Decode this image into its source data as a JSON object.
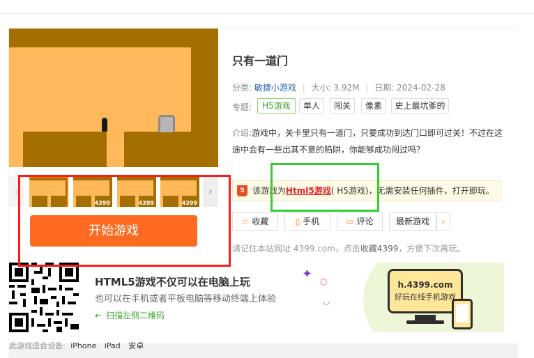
{
  "game": {
    "title": "只有一道门",
    "category_label": "分类:",
    "category": "敏捷小游戏",
    "size_label": "大小:",
    "size": "3.92M",
    "date_label": "日期:",
    "date": "2024-02-28",
    "topics_label": "专题:",
    "topics": [
      "H5游戏",
      "单人",
      "闯关",
      "像素",
      "史上最坑爹的"
    ],
    "intro_label": "介绍:",
    "intro": "游戏中，关卡里只有一道门，只要成功到达门口即可过关！不过在这途中会有一些出其不意的陷阱，你能够成功闯过吗？"
  },
  "thumbnails": {
    "items": [
      {
        "tag": ""
      },
      {
        "tag": "4399"
      },
      {
        "tag": "4399"
      },
      {
        "tag": "4399"
      }
    ],
    "prev_arrow": "‹",
    "next_arrow": "›"
  },
  "start_button": "开始游戏",
  "h5_notice": {
    "icon": "5",
    "prefix": "该游戏为",
    "highlight": "Html5游戏",
    "suffix": "( H5游戏)，无需安装任何插件，打开即玩。"
  },
  "actions": {
    "favorite": "收藏",
    "mobile": "手机",
    "comment": "评论",
    "latest": "最新游戏",
    "more": "›"
  },
  "remember": {
    "prefix": "请记住本站网址 4399.com，点击",
    "bold": "收藏4399",
    "suffix": "，方便下次再玩。"
  },
  "promo": {
    "title": "HTML5游戏不仅可以在电脑上玩",
    "subtitle": "也可以在手机或者平板电脑等移动终端上体验",
    "scan": "扫描左侧二维码",
    "scan_arrow": "←",
    "site": "h.4399.com",
    "slogan": "好玩在线手机游戏"
  },
  "devices": {
    "label": "此游戏适合设备:",
    "list": [
      "iPhone",
      "iPad",
      "安卓"
    ]
  },
  "colors": {
    "accent": "#ff6a21",
    "link": "#2566b0",
    "green": "#3fa52f",
    "annotation_red": "#ff1a1a",
    "annotation_green": "#2fd02f"
  }
}
